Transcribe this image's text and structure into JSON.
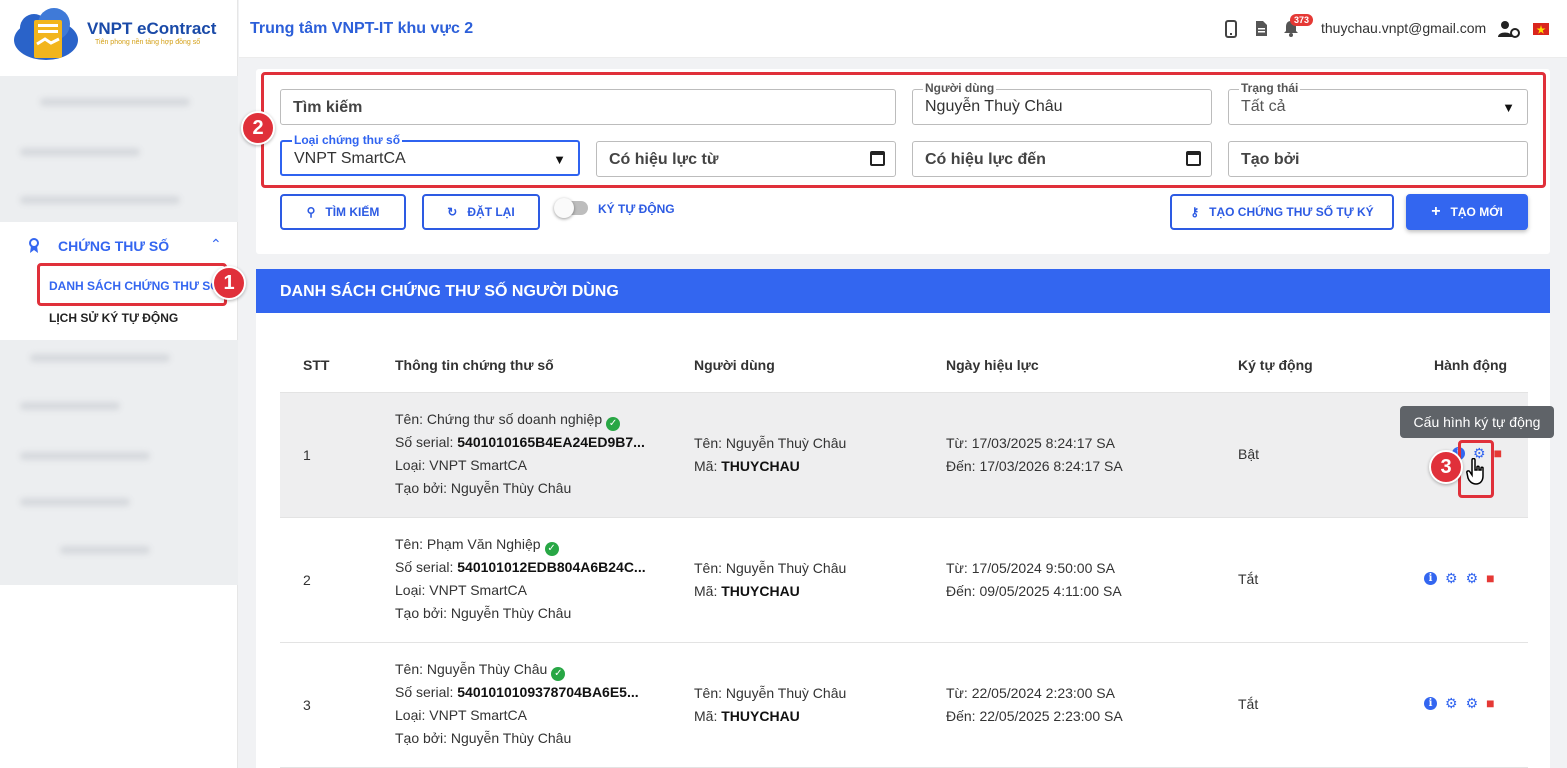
{
  "brand": {
    "title": "VNPT eContract",
    "subtitle": "Tiên phong nền tảng hợp đồng số"
  },
  "header": {
    "org": "Trung tâm VNPT-IT khu vực 2",
    "notifications": "373",
    "email": "thuychau.vnpt@gmail.com",
    "icons": [
      "mobile-icon",
      "document-icon",
      "bell-icon",
      "user-settings-icon",
      "flag-vn-icon"
    ]
  },
  "sidebar": {
    "group": "CHỨNG THƯ SỐ",
    "items": [
      {
        "label": "DANH SÁCH CHỨNG THƯ SỐ",
        "active": true
      },
      {
        "label": "LỊCH SỬ KÝ TỰ ĐỘNG",
        "active": false
      }
    ]
  },
  "filters": {
    "search_placeholder": "Tìm kiếm",
    "user_label": "Người dùng",
    "user_value": "Nguyễn Thuỳ Châu",
    "status_label": "Trạng thái",
    "status_value": "Tất cả",
    "cert_type_label": "Loại chứng thư số",
    "cert_type_value": "VNPT SmartCA",
    "valid_from_placeholder": "Có hiệu lực từ",
    "valid_to_placeholder": "Có hiệu lực đến",
    "created_by_placeholder": "Tạo bởi"
  },
  "actions": {
    "search": "TÌM KIẾM",
    "reset": "ĐẶT LẠI",
    "auto_sign": "KÝ TỰ ĐỘNG",
    "self_sign": "TẠO CHỨNG THƯ SỐ TỰ KÝ",
    "create": "TẠO MỚI"
  },
  "list": {
    "title": "DANH SÁCH CHỨNG THƯ SỐ NGƯỜI DÙNG",
    "columns": [
      "STT",
      "Thông tin chứng thư số",
      "Người dùng",
      "Ngày hiệu lực",
      "Ký tự động",
      "Hành động"
    ],
    "rows": [
      {
        "stt": "1",
        "name": "Tên: Chứng thư số doanh nghiệp",
        "serial_label": "Số serial: ",
        "serial": "5401010165B4EA24ED9B7...",
        "type": "Loại: VNPT SmartCA",
        "created": "Tạo bởi: Nguyễn Thùy Châu",
        "user_name": "Tên: Nguyễn Thuỳ Châu",
        "code_label": "Mã: ",
        "code": "THUYCHAU",
        "from": "Từ: 17/03/2025 8:24:17 SA",
        "to": "Đến: 17/03/2026 8:24:17 SA",
        "auto": "Bật"
      },
      {
        "stt": "2",
        "name": "Tên: Phạm Văn Nghiệp",
        "serial_label": "Số serial: ",
        "serial": "540101012EDB804A6B24C...",
        "type": "Loại: VNPT SmartCA",
        "created": "Tạo bởi: Nguyễn Thùy Châu",
        "user_name": "Tên: Nguyễn Thuỳ Châu",
        "code_label": "Mã: ",
        "code": "THUYCHAU",
        "from": "Từ: 17/05/2024 9:50:00 SA",
        "to": "Đến: 09/05/2025 4:11:00 SA",
        "auto": "Tắt"
      },
      {
        "stt": "3",
        "name": "Tên: Nguyễn Thùy Châu",
        "serial_label": "Số serial: ",
        "serial": "5401010109378704BA6E5...",
        "type": "Loại: VNPT SmartCA",
        "created": "Tạo bởi: Nguyễn Thùy Châu",
        "user_name": "Tên: Nguyễn Thuỳ Châu",
        "code_label": "Mã: ",
        "code": "THUYCHAU",
        "from": "Từ: 22/05/2024 2:23:00 SA",
        "to": "Đến: 22/05/2025 2:23:00 SA",
        "auto": "Tắt"
      }
    ]
  },
  "tooltip": "Cấu hình ký tự động",
  "markers": [
    "1",
    "2",
    "3"
  ],
  "colors": {
    "primary": "#3366f0",
    "highlight": "#e0303a",
    "success": "#28a745",
    "danger": "#e53935"
  }
}
